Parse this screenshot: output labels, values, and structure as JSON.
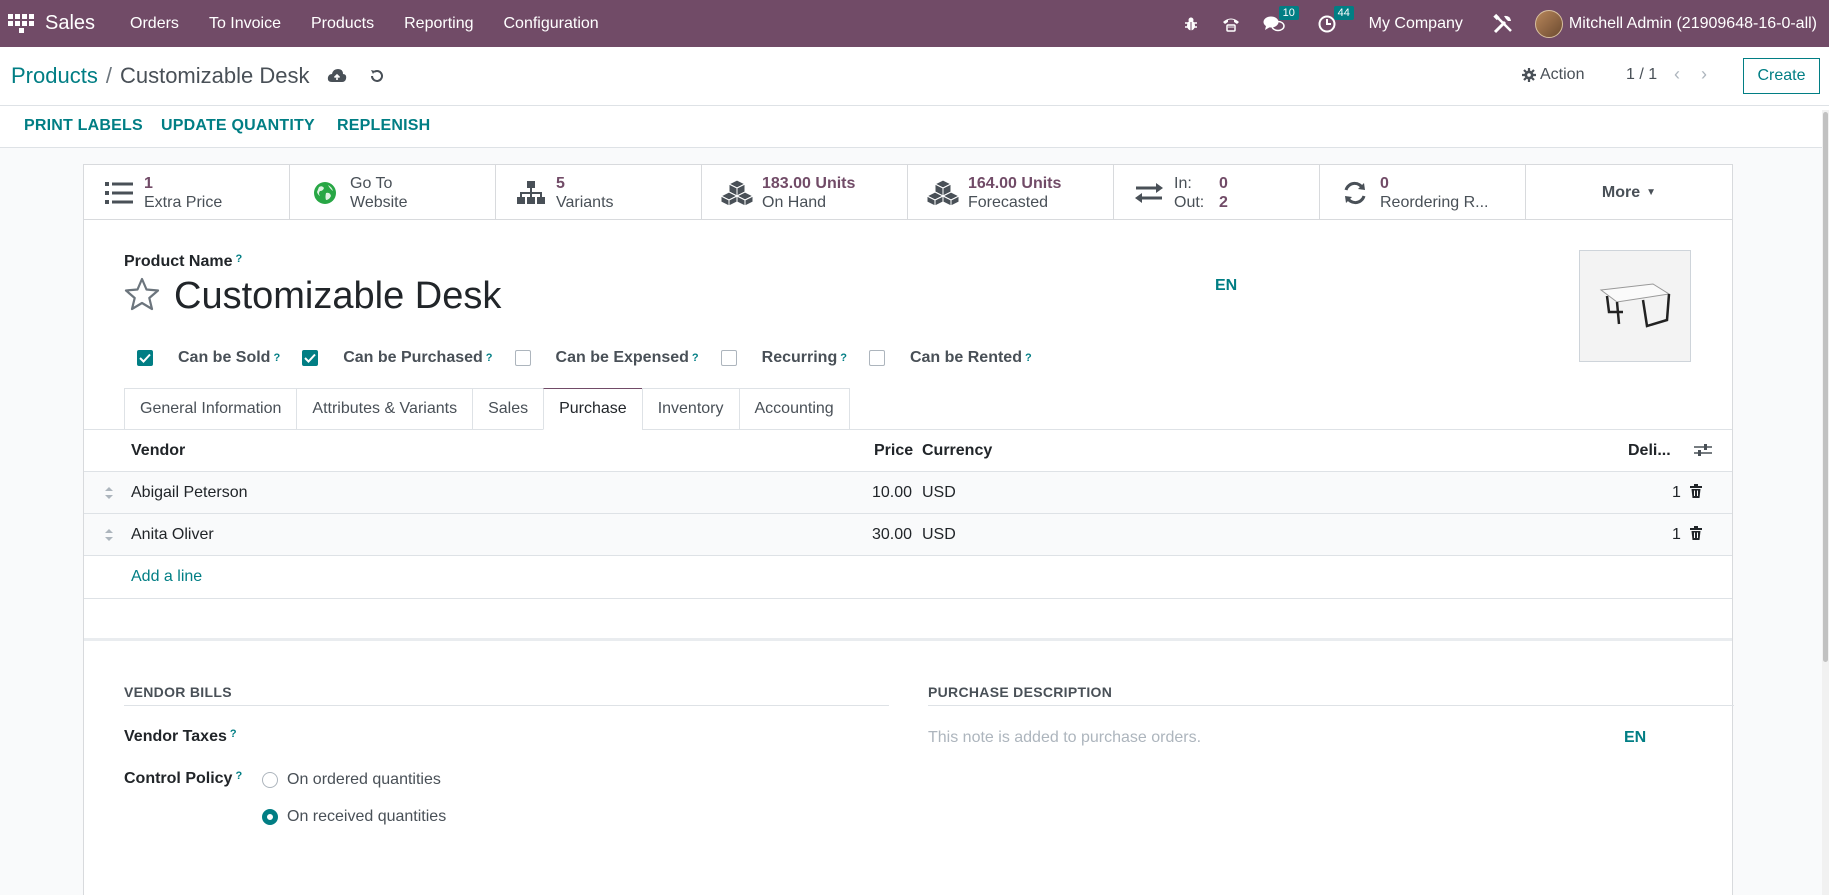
{
  "navbar": {
    "app_name": "Sales",
    "menus": [
      "Orders",
      "To Invoice",
      "Products",
      "Reporting",
      "Configuration"
    ],
    "messages_count": "10",
    "activities_count": "44",
    "company": "My Company",
    "user": "Mitchell Admin (21909648-16-0-all)"
  },
  "control": {
    "breadcrumb_parent": "Products",
    "breadcrumb_sep": "/",
    "breadcrumb_current": "Customizable Desk",
    "action_label": "Action",
    "pager": "1 / 1",
    "create_label": "Create"
  },
  "statusbar": {
    "print_labels": "PRINT LABELS",
    "update_quantity": "UPDATE QUANTITY",
    "replenish": "REPLENISH"
  },
  "smart_buttons": {
    "extra_price": {
      "value": "1",
      "label": "Extra Price"
    },
    "website": {
      "value": "Go To",
      "label": "Website"
    },
    "variants": {
      "value": "5",
      "label": "Variants"
    },
    "on_hand": {
      "value": "183.00 Units",
      "label": "On Hand"
    },
    "forecasted": {
      "value": "164.00 Units",
      "label": "Forecasted"
    },
    "in_out": {
      "in_label": "In:",
      "in_value": "0",
      "out_label": "Out:",
      "out_value": "2"
    },
    "reordering": {
      "value": "0",
      "label": "Reordering R..."
    },
    "more": "More"
  },
  "product": {
    "name_label": "Product Name",
    "help_mark": "?",
    "name": "Customizable Desk",
    "lang": "EN",
    "checkboxes": [
      {
        "label": "Can be Sold",
        "checked": true
      },
      {
        "label": "Can be Purchased",
        "checked": true
      },
      {
        "label": "Can be Expensed",
        "checked": false
      },
      {
        "label": "Recurring",
        "checked": false
      },
      {
        "label": "Can be Rented",
        "checked": false
      }
    ]
  },
  "tabs": [
    "General Information",
    "Attributes & Variants",
    "Sales",
    "Purchase",
    "Inventory",
    "Accounting"
  ],
  "active_tab": "Purchase",
  "vendor_table": {
    "headers": {
      "vendor": "Vendor",
      "price": "Price",
      "currency": "Currency",
      "delivery": "Deli..."
    },
    "rows": [
      {
        "vendor": "Abigail Peterson",
        "price": "10.00",
        "currency": "USD",
        "delivery": "1"
      },
      {
        "vendor": "Anita Oliver",
        "price": "30.00",
        "currency": "USD",
        "delivery": "1"
      }
    ],
    "add_line": "Add a line"
  },
  "vendor_bills": {
    "section_title": "VENDOR BILLS",
    "taxes_label": "Vendor Taxes",
    "control_policy_label": "Control Policy",
    "options": [
      {
        "label": "On ordered quantities",
        "selected": false
      },
      {
        "label": "On received quantities",
        "selected": true
      }
    ]
  },
  "purchase_description": {
    "section_title": "PURCHASE DESCRIPTION",
    "placeholder": "This note is added to purchase orders.",
    "lang": "EN"
  },
  "colors": {
    "brand": "#714b67",
    "accent": "#017e84"
  }
}
